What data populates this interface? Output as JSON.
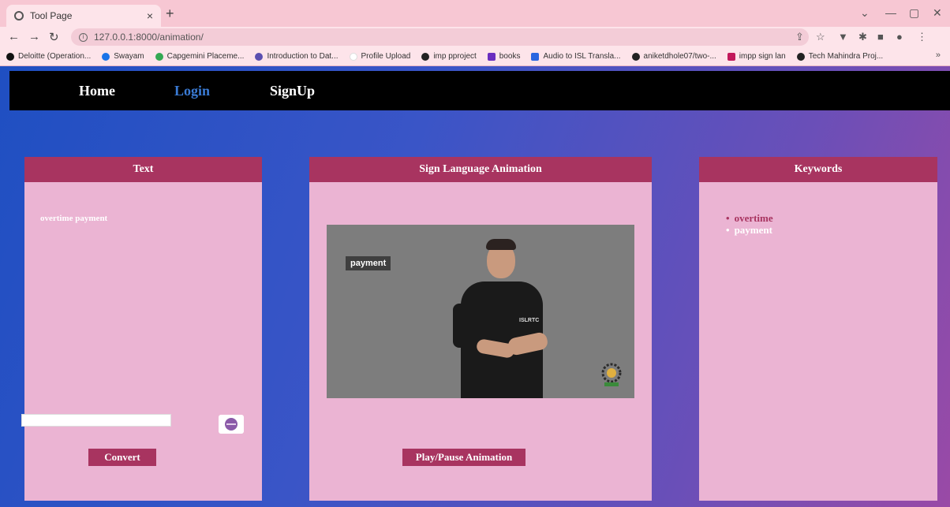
{
  "browser": {
    "tab_title": "Tool Page",
    "tab_close": "×",
    "new_tab": "+",
    "url": "127.0.0.1:8000/animation/",
    "bookmarks": [
      {
        "label": "Deloitte (Operation...",
        "color": "#111111"
      },
      {
        "label": "Swayam",
        "color": "#1a73e8"
      },
      {
        "label": "Capgemini Placeme...",
        "color": "#34a853"
      },
      {
        "label": "Introduction to Dat...",
        "color": "#5b4fb0"
      },
      {
        "label": "Profile Upload",
        "color": "#ffffff"
      },
      {
        "label": "imp pproject",
        "color": "#222222"
      },
      {
        "label": "books",
        "color": "#6a2dbf"
      },
      {
        "label": "Audio to ISL Transla...",
        "color": "#2a66e0"
      },
      {
        "label": "aniketdhole07/two-...",
        "color": "#222222"
      },
      {
        "label": "impp sign lan",
        "color": "#c2185b"
      },
      {
        "label": "Tech Mahindra Proj...",
        "color": "#222222"
      }
    ],
    "more_bookmarks": "»"
  },
  "nav": {
    "home": "Home",
    "login": "Login",
    "signup": "SignUp",
    "login_color": "#3a7bd5"
  },
  "text_card": {
    "title": "Text",
    "content": "overtime payment",
    "input_value": "",
    "convert_label": "Convert"
  },
  "animation_card": {
    "title": "Sign Language Animation",
    "caption": "payment",
    "shirt_text": "ISLRTC",
    "play_label": "Play/Pause Animation"
  },
  "keywords_card": {
    "title": "Keywords",
    "items": [
      "overtime",
      "payment"
    ],
    "active_index": 0
  },
  "colors": {
    "header": "#a83460",
    "card": "#ebb4d3"
  }
}
